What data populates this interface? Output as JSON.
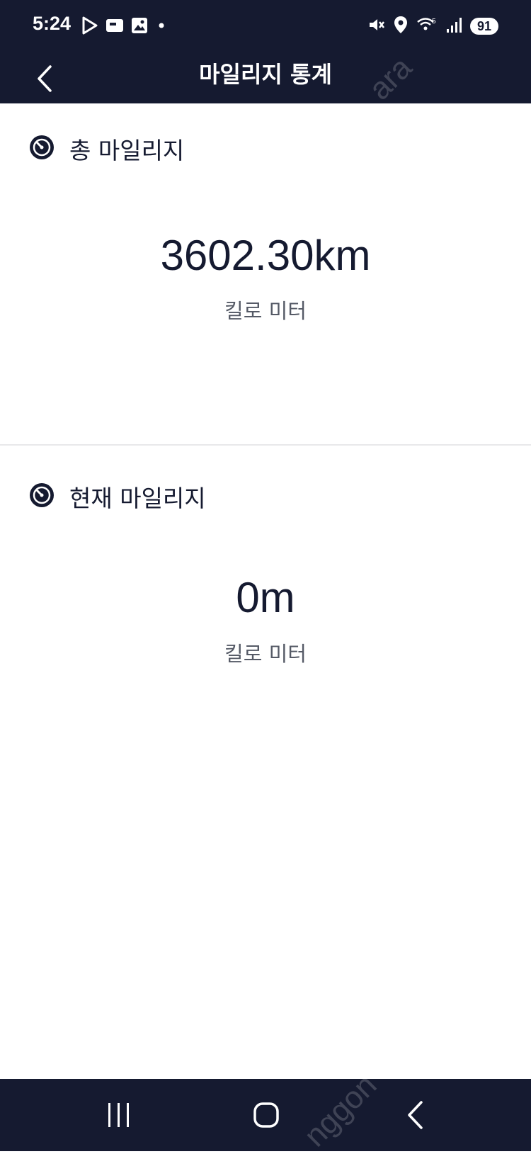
{
  "status_bar": {
    "time": "5:24",
    "battery": "91",
    "left_icons": [
      "play-store-icon",
      "news-icon",
      "gallery-icon",
      "dot-icon"
    ],
    "right_icons": [
      "mute-icon",
      "location-icon",
      "wifi-icon",
      "signal-icon"
    ]
  },
  "header": {
    "title": "마일리지 통계",
    "back_icon": "chevron-left-icon"
  },
  "total": {
    "title": "총 마일리지",
    "value": "3602.30km",
    "unit": "킬로 미터",
    "icon": "timer-icon"
  },
  "current": {
    "title": "현재 마일리지",
    "value": "0m",
    "unit": "킬로 미터",
    "icon": "timer-icon"
  },
  "nav": {
    "buttons": [
      "recent-apps-icon",
      "home-icon",
      "back-icon"
    ]
  },
  "colors": {
    "header_bg": "#151a30",
    "text_dark": "#151a30",
    "text_muted": "#555a66"
  }
}
